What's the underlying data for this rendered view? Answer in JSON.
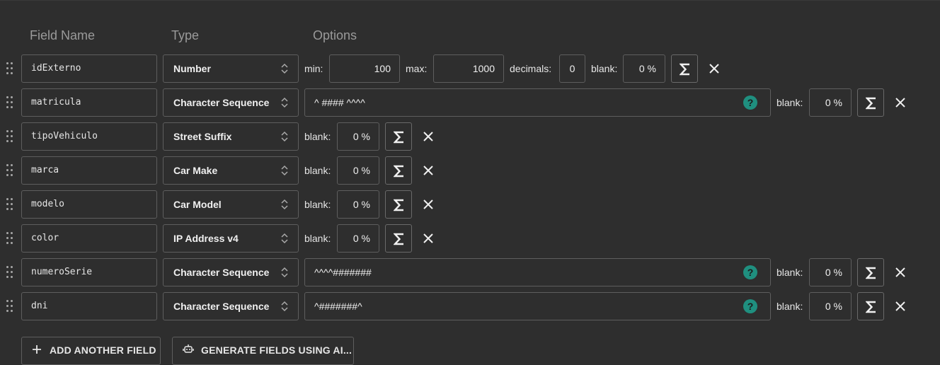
{
  "headers": {
    "field_name": "Field Name",
    "type": "Type",
    "options": "Options"
  },
  "labels": {
    "min": "min:",
    "max": "max:",
    "decimals": "decimals:",
    "blank": "blank:"
  },
  "help_glyph": "?",
  "rows": [
    {
      "name": "idExterno",
      "type": "Number",
      "min": "100",
      "max": "1000",
      "decimals": "0",
      "blank": "0 %"
    },
    {
      "name": "matricula",
      "type": "Character Sequence",
      "pattern": "^ #### ^^^^",
      "blank": "0 %"
    },
    {
      "name": "tipoVehiculo",
      "type": "Street Suffix",
      "blank": "0 %"
    },
    {
      "name": "marca",
      "type": "Car Make",
      "blank": "0 %"
    },
    {
      "name": "modelo",
      "type": "Car Model",
      "blank": "0 %"
    },
    {
      "name": "color",
      "type": "IP Address v4",
      "blank": "0 %"
    },
    {
      "name": "numeroSerie",
      "type": "Character Sequence",
      "pattern": "^^^^#######",
      "blank": "0 %"
    },
    {
      "name": "dni",
      "type": "Character Sequence",
      "pattern": "^#######^",
      "blank": "0 %"
    }
  ],
  "buttons": {
    "add_field": "ADD ANOTHER FIELD",
    "generate_ai": "GENERATE FIELDS USING AI..."
  },
  "icons": {
    "drag": "drag-handle-icon",
    "select": "chevron-updown-icon",
    "formula": "sigma-icon",
    "remove": "close-icon",
    "help": "help-icon",
    "add": "plus-icon",
    "ai": "robot-icon"
  },
  "colors": {
    "background": "#2e2e2e",
    "help_accent": "#1f8f7f",
    "border": "#5e5e5e"
  }
}
